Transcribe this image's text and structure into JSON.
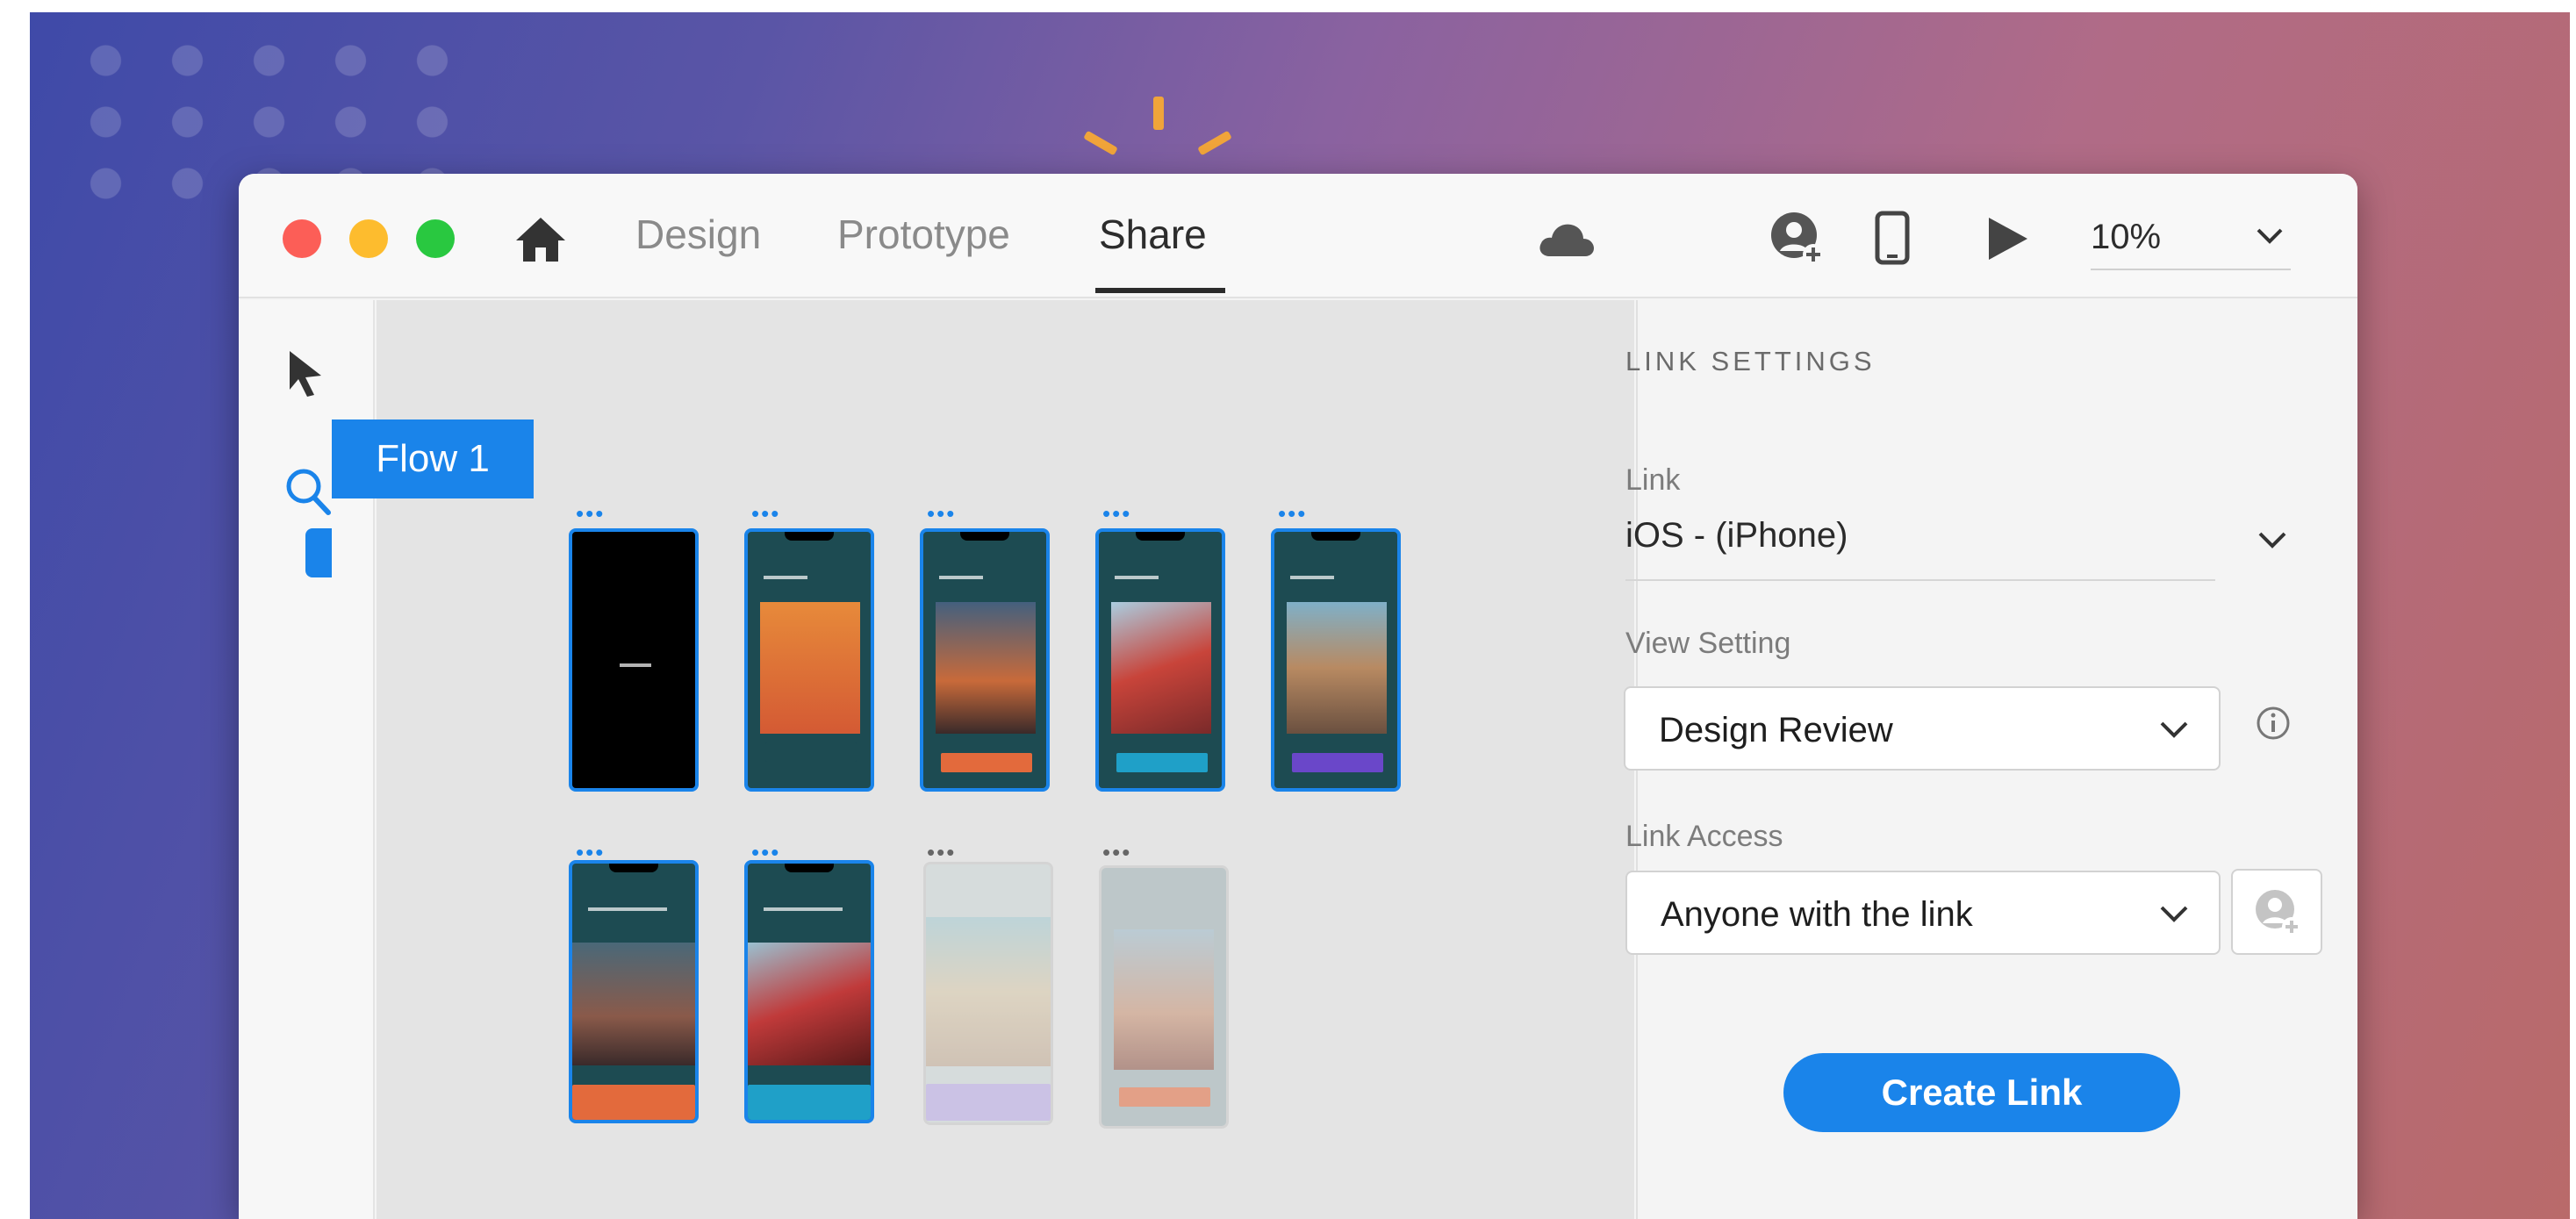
{
  "window": {
    "tabs": [
      {
        "label": "Design",
        "active": false
      },
      {
        "label": "Prototype",
        "active": false
      },
      {
        "label": "Share",
        "active": true
      }
    ],
    "zoom": "10%",
    "icons": [
      "home-icon",
      "cloud-icon",
      "invite-user-icon",
      "mobile-preview-icon",
      "play-icon",
      "chevron-down-icon"
    ]
  },
  "tools": [
    "select-arrow-icon",
    "search-icon"
  ],
  "canvas": {
    "flow_label": "Flow 1",
    "artboard_row1_accents": [
      "#000000",
      "#e36a3c",
      "#e36a3c",
      "#1fa0c8",
      "#6a47c9"
    ],
    "artboard_row2_accents": [
      "#e36a3c",
      "#1fa0c8",
      "#b8a8e6",
      "#e36a3c"
    ]
  },
  "panel": {
    "heading": "LINK SETTINGS",
    "link_label": "Link",
    "link_value": "iOS - (iPhone)",
    "view_setting_label": "View Setting",
    "view_setting_value": "Design Review",
    "link_access_label": "Link Access",
    "link_access_value": "Anyone with the link",
    "create_button": "Create Link"
  },
  "colors": {
    "accent": "#1a84ea",
    "close": "#fc5e57",
    "minimize": "#fdbc2e",
    "maximize": "#29c840"
  }
}
